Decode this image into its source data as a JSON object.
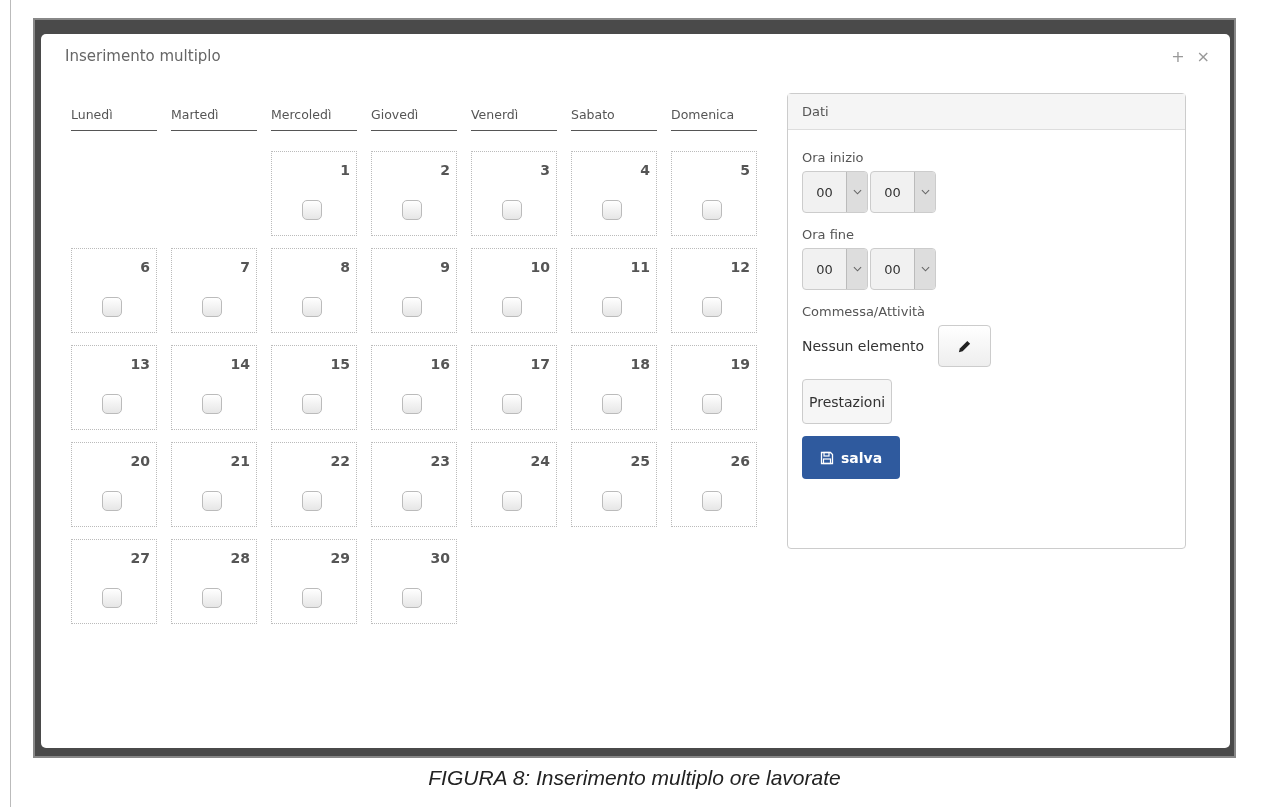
{
  "dialog": {
    "title": "Inserimento multiplo",
    "actions": [
      "+",
      "×"
    ]
  },
  "calendar": {
    "weekdays": [
      "Lunedì",
      "Martedì",
      "Mercoledì",
      "Giovedì",
      "Venerdì",
      "Sabato",
      "Domenica"
    ],
    "weeks": [
      {
        "kind": "lead",
        "days": [
          {
            "day": "1",
            "checked": false
          },
          {
            "day": "2",
            "checked": false
          },
          {
            "day": "3",
            "checked": false
          },
          {
            "day": "4",
            "checked": false
          },
          {
            "day": "5",
            "checked": false
          }
        ]
      },
      {
        "kind": "full",
        "days": [
          {
            "day": "6",
            "checked": false
          },
          {
            "day": "7",
            "checked": false
          },
          {
            "day": "8",
            "checked": false
          },
          {
            "day": "9",
            "checked": false
          },
          {
            "day": "10",
            "checked": false
          },
          {
            "day": "11",
            "checked": false
          },
          {
            "day": "12",
            "checked": false
          }
        ]
      },
      {
        "kind": "full",
        "days": [
          {
            "day": "13",
            "checked": false
          },
          {
            "day": "14",
            "checked": false
          },
          {
            "day": "15",
            "checked": false
          },
          {
            "day": "16",
            "checked": false
          },
          {
            "day": "17",
            "checked": false
          },
          {
            "day": "18",
            "checked": false
          },
          {
            "day": "19",
            "checked": false
          }
        ]
      },
      {
        "kind": "full",
        "days": [
          {
            "day": "20",
            "checked": false
          },
          {
            "day": "21",
            "checked": false
          },
          {
            "day": "22",
            "checked": false
          },
          {
            "day": "23",
            "checked": false
          },
          {
            "day": "24",
            "checked": false
          },
          {
            "day": "25",
            "checked": false
          },
          {
            "day": "26",
            "checked": false
          }
        ]
      },
      {
        "kind": "tail",
        "days": [
          {
            "day": "27",
            "checked": false
          },
          {
            "day": "28",
            "checked": false
          },
          {
            "day": "29",
            "checked": false
          },
          {
            "day": "30",
            "checked": false
          }
        ]
      }
    ]
  },
  "panel": {
    "title": "Dati",
    "start": {
      "label": "Ora inizio",
      "hour": "00",
      "minute": "00"
    },
    "end": {
      "label": "Ora fine",
      "hour": "00",
      "minute": "00"
    },
    "job": {
      "label": "Commessa/Attività",
      "value": "Nessun elemento"
    },
    "services_button": "Prestazioni",
    "save_button": "salva"
  },
  "caption": "FIGURA 8: Inserimento multiplo ore lavorate"
}
